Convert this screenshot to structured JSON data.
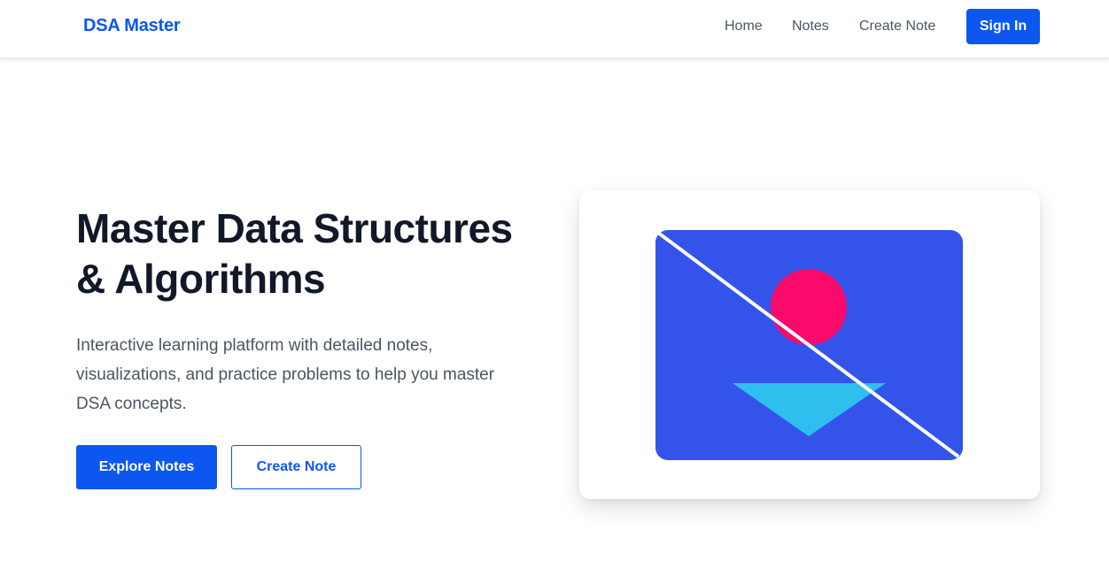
{
  "navbar": {
    "brand": "DSA Master",
    "links": [
      "Home",
      "Notes",
      "Create Note"
    ],
    "sign_in": "Sign In"
  },
  "hero": {
    "title_line1": "Master Data Structures",
    "title_line2": "& Algorithms",
    "subtitle_line1": "Interactive learning platform with detailed notes,",
    "subtitle_line2": "visualizations, and practice problems to help you master",
    "subtitle_line3": "DSA concepts.",
    "primary_button": "Explore Notes",
    "secondary_button": "Create Note"
  },
  "image": {
    "icon": "broken-image-placeholder",
    "colors": {
      "background": "#3453eb",
      "circle": "#f90a6b",
      "triangle": "#2ebfee",
      "slash": "#ffffff"
    }
  },
  "colors": {
    "brand": "#0b57f0",
    "heading": "#111827",
    "body_text": "#4b5563",
    "nav_text": "#4b5563"
  }
}
